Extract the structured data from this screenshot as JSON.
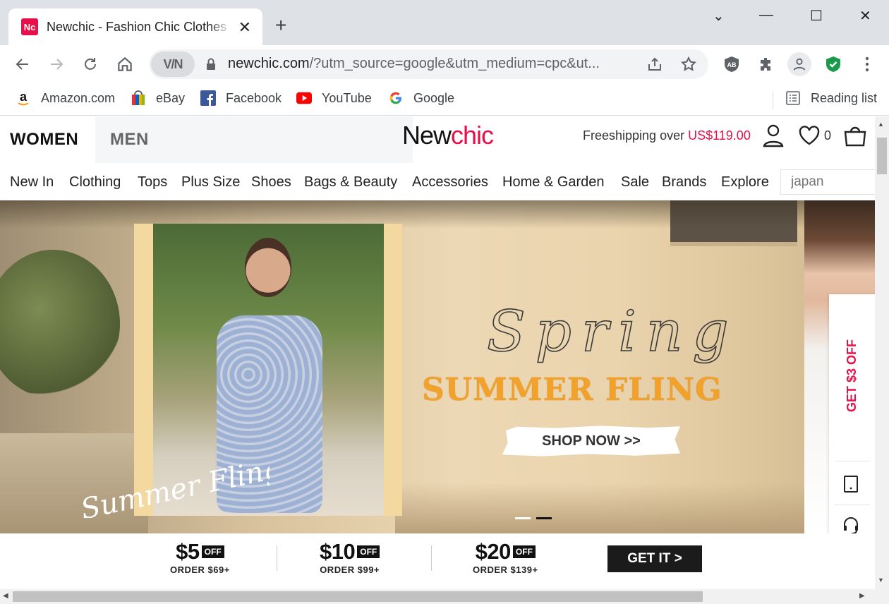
{
  "browser": {
    "tab_title": "Newchic - Fashion Chic Clothes Online",
    "favicon_text": "Nc",
    "new_tab": "+",
    "close_tab": "✕",
    "window_controls": [
      "⌄",
      "—",
      "☐",
      "✕"
    ],
    "vpn_label": "V/N",
    "url_domain": "newchic.com",
    "url_rest": "/?utm_source=google&utm_medium=cpc&ut...",
    "extension_ab_label": "AB"
  },
  "bookmarks": {
    "items": [
      {
        "label": "Amazon.com",
        "icon": "amazon-icon"
      },
      {
        "label": "eBay",
        "icon": "ebay-icon"
      },
      {
        "label": "Facebook",
        "icon": "facebook-icon"
      },
      {
        "label": "YouTube",
        "icon": "youtube-icon"
      },
      {
        "label": "Google",
        "icon": "google-icon"
      }
    ],
    "reading_list": "Reading list"
  },
  "header": {
    "women": "WOMEN",
    "men": "MEN",
    "brand_a": "New",
    "brand_b": "chic",
    "shipping_text": "Freeshipping over ",
    "shipping_price": "US$119.00",
    "wishlist_count": "0"
  },
  "nav": {
    "items": [
      "New In",
      "Clothing",
      "Tops",
      "Plus Size",
      "Shoes",
      "Bags & Beauty",
      "Accessories",
      "Home & Garden",
      "Sale",
      "Brands",
      "Explore"
    ],
    "search_placeholder": "japan"
  },
  "hero": {
    "script_title": "Spring",
    "headline": "SUMMER FLING",
    "cta": "SHOP NOW >>",
    "photo_script": "Summer Fling",
    "slide_count": 2,
    "active_slide": 2
  },
  "side_widget": {
    "coupon_label": "GET $3 OFF"
  },
  "coupons": {
    "items": [
      {
        "amount": "$5",
        "off": "OFF",
        "order": "ORDER $69+"
      },
      {
        "amount": "$10",
        "off": "OFF",
        "order": "ORDER $99+"
      },
      {
        "amount": "$20",
        "off": "OFF",
        "order": "ORDER $139+"
      }
    ],
    "cta": "GET IT >"
  },
  "colors": {
    "brand_accent": "#e8104a",
    "headline_orange": "#f2a12a",
    "dark_button": "#1b1b1b"
  }
}
